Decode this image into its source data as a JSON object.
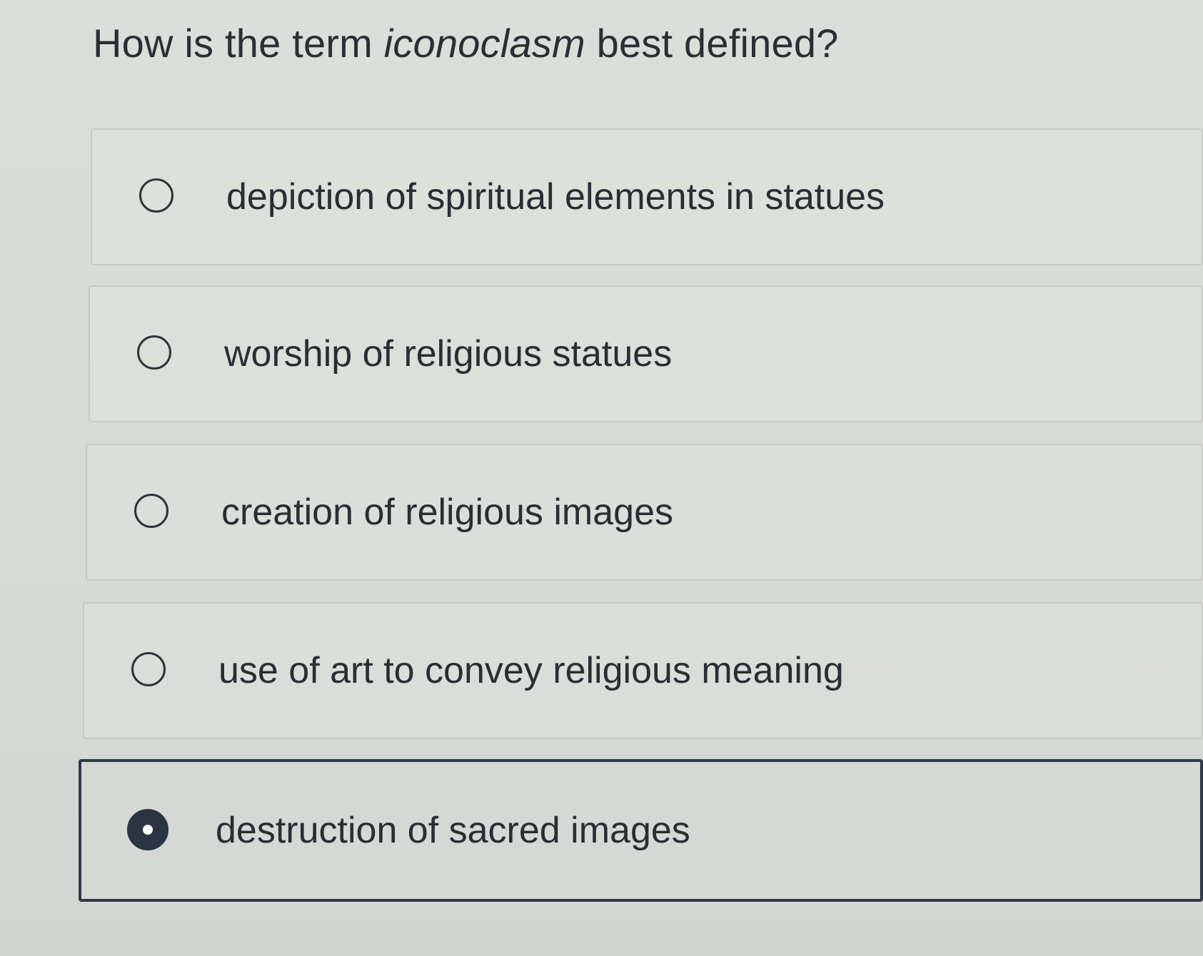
{
  "question": {
    "prefix": "How is the term ",
    "term": "iconoclasm",
    "suffix": " best defined?"
  },
  "options": [
    {
      "label": "depiction of spiritual elements in statues",
      "selected": false
    },
    {
      "label": "worship of religious statues",
      "selected": false
    },
    {
      "label": "creation of religious images",
      "selected": false
    },
    {
      "label": "use of art to convey religious meaning",
      "selected": false
    },
    {
      "label": "destruction of sacred images",
      "selected": true
    }
  ],
  "icons": {
    "unselected": "radio-unselected-icon",
    "selected": "radio-selected-icon"
  },
  "colors": {
    "background": "#d8dad7",
    "text": "#2a2e33",
    "selected_border": "#303948",
    "selected_fill": "#2c3441"
  }
}
